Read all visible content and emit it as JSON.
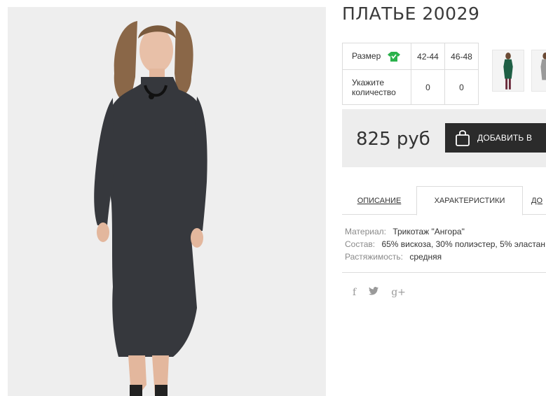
{
  "product": {
    "title": "ПЛАТЬЕ 20029"
  },
  "size_table": {
    "size_label": "Размер",
    "sizes": [
      "42-44",
      "46-48"
    ],
    "quantity_label": "Укажите количество",
    "quantities": [
      "0",
      "0"
    ]
  },
  "price": {
    "value": "825 руб",
    "cart_button_label": "ДОБАВИТЬ В"
  },
  "tabs": {
    "description": "ОПИСАНИЕ",
    "characteristics": "ХАРАКТЕРИСТИКИ",
    "third": "ДО"
  },
  "specs": [
    {
      "key": "Материал:",
      "value": "Трикотаж \"Ангора\""
    },
    {
      "key": "Состав:",
      "value": "65% вискоза, 30% полиэстер, 5% эластан"
    },
    {
      "key": "Растяжимость:",
      "value": "средняя"
    }
  ],
  "social": {
    "facebook": "f",
    "twitter": "🐦",
    "google": "g+"
  },
  "colors": {
    "accent_green": "#2bb24c",
    "button_dark": "#2b2b2b",
    "price_panel": "#ededed"
  },
  "icons": [
    "shirt-icon",
    "shopping-bag-icon",
    "facebook-icon",
    "twitter-icon",
    "google-plus-icon"
  ]
}
